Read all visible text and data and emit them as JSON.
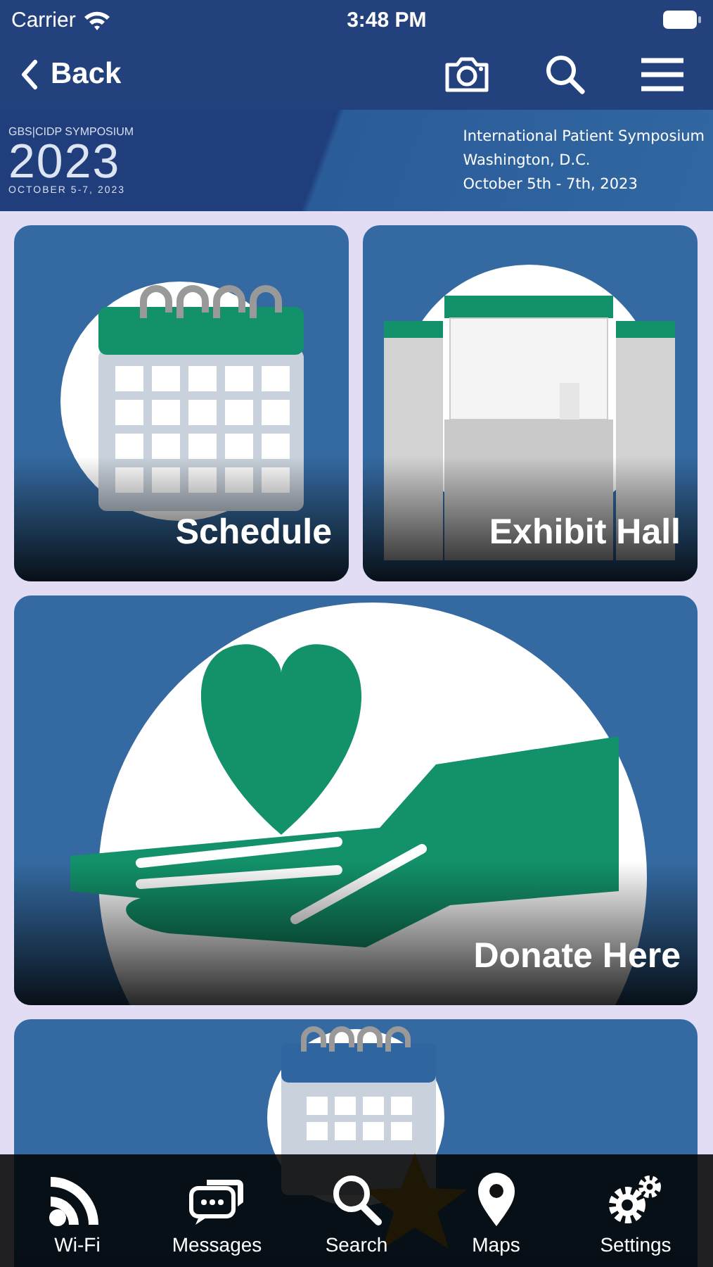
{
  "status_bar": {
    "carrier": "Carrier",
    "time": "3:48 PM"
  },
  "nav": {
    "back_label": "Back"
  },
  "banner": {
    "logo_top": "GBS|CIDP SYMPOSIUM",
    "logo_year": "2023",
    "logo_dates": "OCTOBER 5-7, 2023",
    "info_lines": [
      "International Patient Symposium",
      "Washington, D.C.",
      "October 5th - 7th, 2023"
    ]
  },
  "tiles": [
    {
      "label": "Schedule",
      "kind": "schedule"
    },
    {
      "label": "Exhibit Hall",
      "kind": "exhibit"
    },
    {
      "label": "Donate Here",
      "kind": "donate"
    },
    {
      "kind": "my_schedule"
    }
  ],
  "tab_bar": [
    {
      "label": "Wi-Fi",
      "kind": "wifi"
    },
    {
      "label": "Messages",
      "kind": "messages"
    },
    {
      "label": "Search",
      "kind": "search"
    },
    {
      "label": "Maps",
      "kind": "maps"
    },
    {
      "label": "Settings",
      "kind": "settings"
    }
  ]
}
